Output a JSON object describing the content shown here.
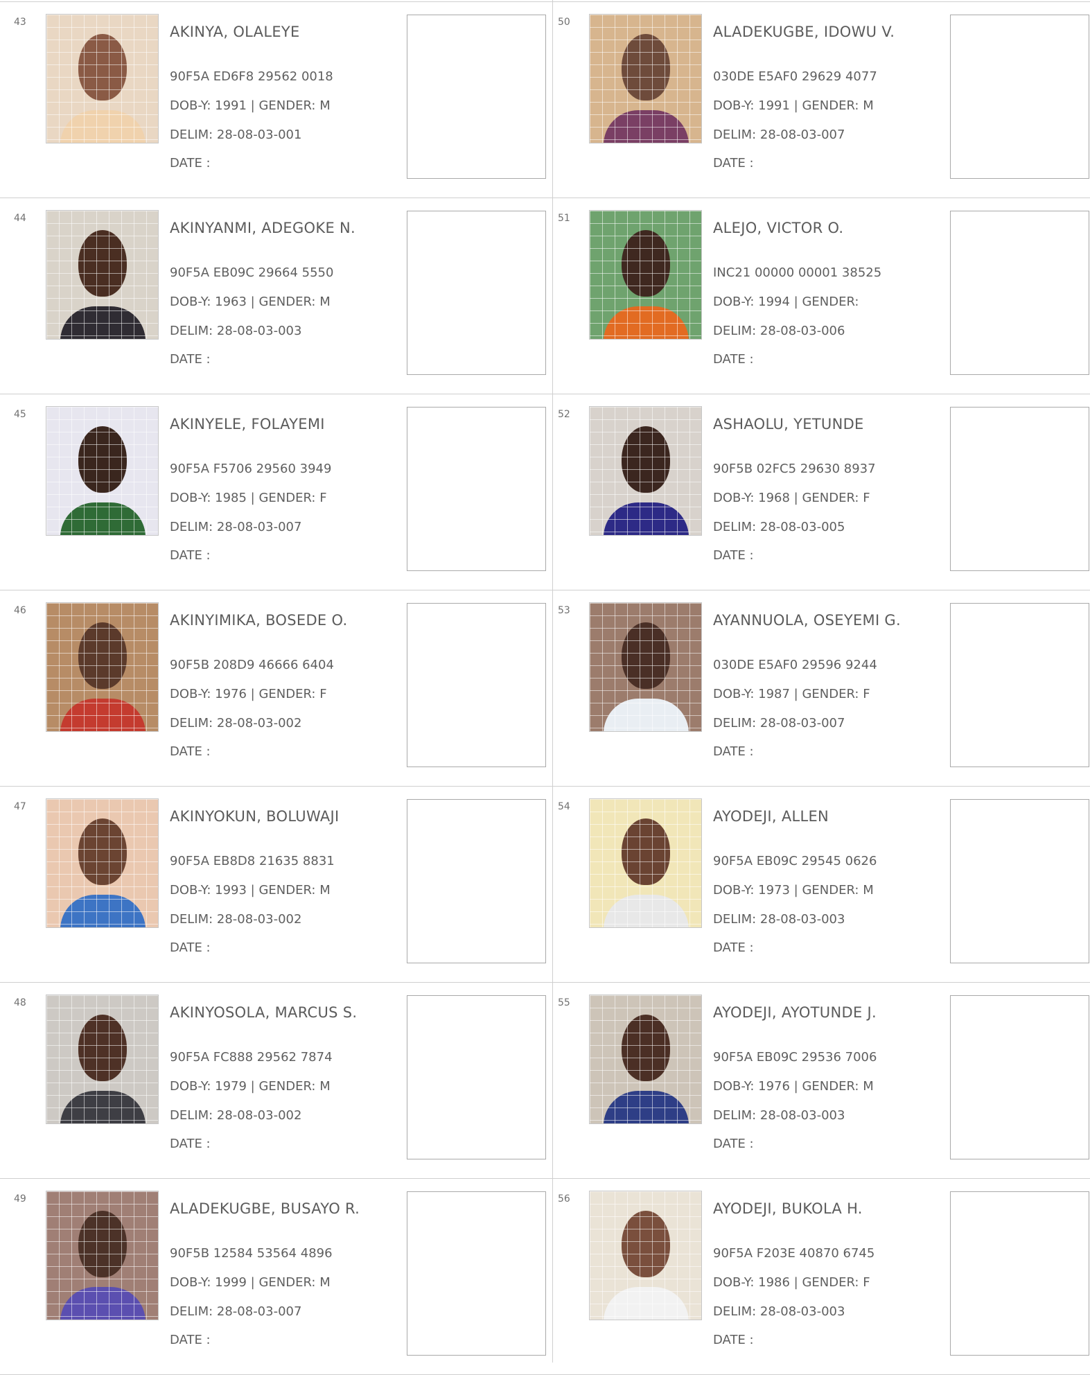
{
  "labels": {
    "dob": "DOB-Y:",
    "gender": "| GENDER:",
    "delim": "DELIM:",
    "date": "DATE  :"
  },
  "left_column": [
    {
      "num": "43",
      "name": "AKINYA, OLALEYE",
      "vin": "90F5A ED6F8 29562 0018",
      "dob": "1991",
      "gender": "M",
      "delim": "28-08-03-001"
    },
    {
      "num": "44",
      "name": "AKINYANMI, ADEGOKE N.",
      "vin": "90F5A EB09C 29664 5550",
      "dob": "1963",
      "gender": "M",
      "delim": "28-08-03-003"
    },
    {
      "num": "45",
      "name": "AKINYELE, FOLAYEMI",
      "vin": "90F5A F5706 29560 3949",
      "dob": "1985",
      "gender": "F",
      "delim": "28-08-03-007"
    },
    {
      "num": "46",
      "name": "AKINYIMIKA, BOSEDE O.",
      "vin": "90F5B 208D9 46666 6404",
      "dob": "1976",
      "gender": "F",
      "delim": "28-08-03-002"
    },
    {
      "num": "47",
      "name": "AKINYOKUN, BOLUWAJI",
      "vin": "90F5A EB8D8 21635 8831",
      "dob": "1993",
      "gender": "M",
      "delim": "28-08-03-002"
    },
    {
      "num": "48",
      "name": "AKINYOSOLA, MARCUS S.",
      "vin": "90F5A FC888 29562 7874",
      "dob": "1979",
      "gender": "M",
      "delim": "28-08-03-002"
    },
    {
      "num": "49",
      "name": "ALADEKUGBE, BUSAYO R.",
      "vin": "90F5B 12584 53564 4896",
      "dob": "1999",
      "gender": "M",
      "delim": "28-08-03-007"
    }
  ],
  "right_column": [
    {
      "num": "50",
      "name": "ALADEKUGBE, IDOWU V.",
      "vin": "030DE E5AF0 29629 4077",
      "dob": "1991",
      "gender": "M",
      "delim": "28-08-03-007"
    },
    {
      "num": "51",
      "name": "ALEJO, VICTOR O.",
      "vin": "INC21 00000 00001 38525",
      "dob": "1994",
      "gender": "",
      "delim": "28-08-03-006"
    },
    {
      "num": "52",
      "name": "ASHAOLU, YETUNDE",
      "vin": "90F5B 02FC5 29630 8937",
      "dob": "1968",
      "gender": "F",
      "delim": "28-08-03-005"
    },
    {
      "num": "53",
      "name": "AYANNUOLA, OSEYEMI G.",
      "vin": "030DE E5AF0 29596 9244",
      "dob": "1987",
      "gender": "F",
      "delim": "28-08-03-007"
    },
    {
      "num": "54",
      "name": "AYODEJI, ALLEN",
      "vin": "90F5A EB09C 29545 0626",
      "dob": "1973",
      "gender": "M",
      "delim": "28-08-03-003"
    },
    {
      "num": "55",
      "name": "AYODEJI, AYOTUNDE J.",
      "vin": "90F5A EB09C 29536 7006",
      "dob": "1976",
      "gender": "M",
      "delim": "28-08-03-003"
    },
    {
      "num": "56",
      "name": "AYODEJI, BUKOLA H.",
      "vin": "90F5A F203E 40870 6745",
      "dob": "1986",
      "gender": "F",
      "delim": "28-08-03-003"
    }
  ],
  "photo_colors": {
    "43": {
      "bg": "#e9d7c3",
      "cloth": "#f0d2ad",
      "skin": "#8a5a45"
    },
    "44": {
      "bg": "#d9d3c9",
      "cloth": "#2f2c33",
      "skin": "#4a2e22"
    },
    "45": {
      "bg": "#e7e6ef",
      "cloth": "#2f6b36",
      "skin": "#3a261e"
    },
    "46": {
      "bg": "#b78c66",
      "cloth": "#c43b2f",
      "skin": "#5b3a2b"
    },
    "47": {
      "bg": "#eac8b0",
      "cloth": "#3d74c4",
      "skin": "#6b4432"
    },
    "48": {
      "bg": "#cdc9c4",
      "cloth": "#3e3e44",
      "skin": "#4e3126"
    },
    "49": {
      "bg": "#a07f75",
      "cloth": "#5b4fb0",
      "skin": "#4c3228"
    },
    "50": {
      "bg": "#d7b58e",
      "cloth": "#7a3f64",
      "skin": "#6e4b3b"
    },
    "51": {
      "bg": "#6fa36e",
      "cloth": "#e26b22",
      "skin": "#3f2820"
    },
    "52": {
      "bg": "#d8d2cc",
      "cloth": "#2d2a86",
      "skin": "#3b261f"
    },
    "53": {
      "bg": "#9c7c6c",
      "cloth": "#e9eef3",
      "skin": "#4a2f26"
    },
    "54": {
      "bg": "#f1e6b8",
      "cloth": "#e8e8e8",
      "skin": "#6a4332"
    },
    "55": {
      "bg": "#cdc4b8",
      "cloth": "#2e3e86",
      "skin": "#4b2f25"
    },
    "56": {
      "bg": "#eae3d6",
      "cloth": "#f2f2f2",
      "skin": "#7a4f3d"
    }
  }
}
